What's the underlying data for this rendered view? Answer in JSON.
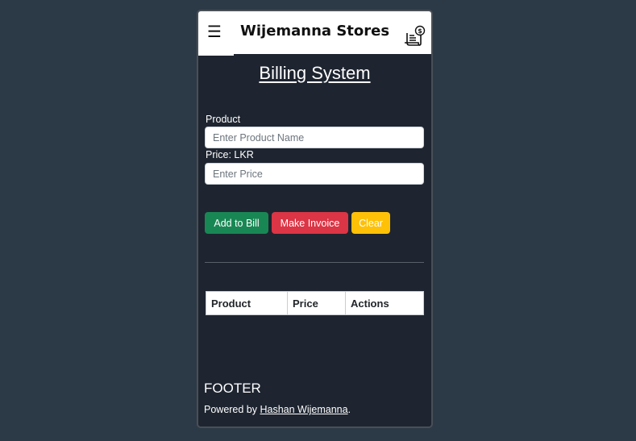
{
  "navbar": {
    "menu_icon": "hamburger-icon",
    "menu_glyph": "☰",
    "brand": "Wijemanna Stores",
    "invoice_icon": "invoice-dollar-icon"
  },
  "page": {
    "title": "Billing System"
  },
  "form": {
    "product_label": "Product",
    "product_placeholder": "Enter Product Name",
    "product_value": "",
    "price_label": "Price: LKR",
    "price_placeholder": "Enter Price",
    "price_value": ""
  },
  "buttons": {
    "add_label": "Add to Bill",
    "invoice_label": "Make Invoice",
    "clear_label": "Clear"
  },
  "table": {
    "headers": [
      "Product",
      "Price",
      "Actions"
    ],
    "rows": []
  },
  "footer": {
    "title": "FOOTER",
    "prefix": "Powered by ",
    "author": "Hashan Wijemanna",
    "suffix": "."
  },
  "colors": {
    "background": "#2c3a47",
    "panel": "#1e2530",
    "success": "#198754",
    "danger": "#dc3545",
    "warning": "#ffc107"
  }
}
